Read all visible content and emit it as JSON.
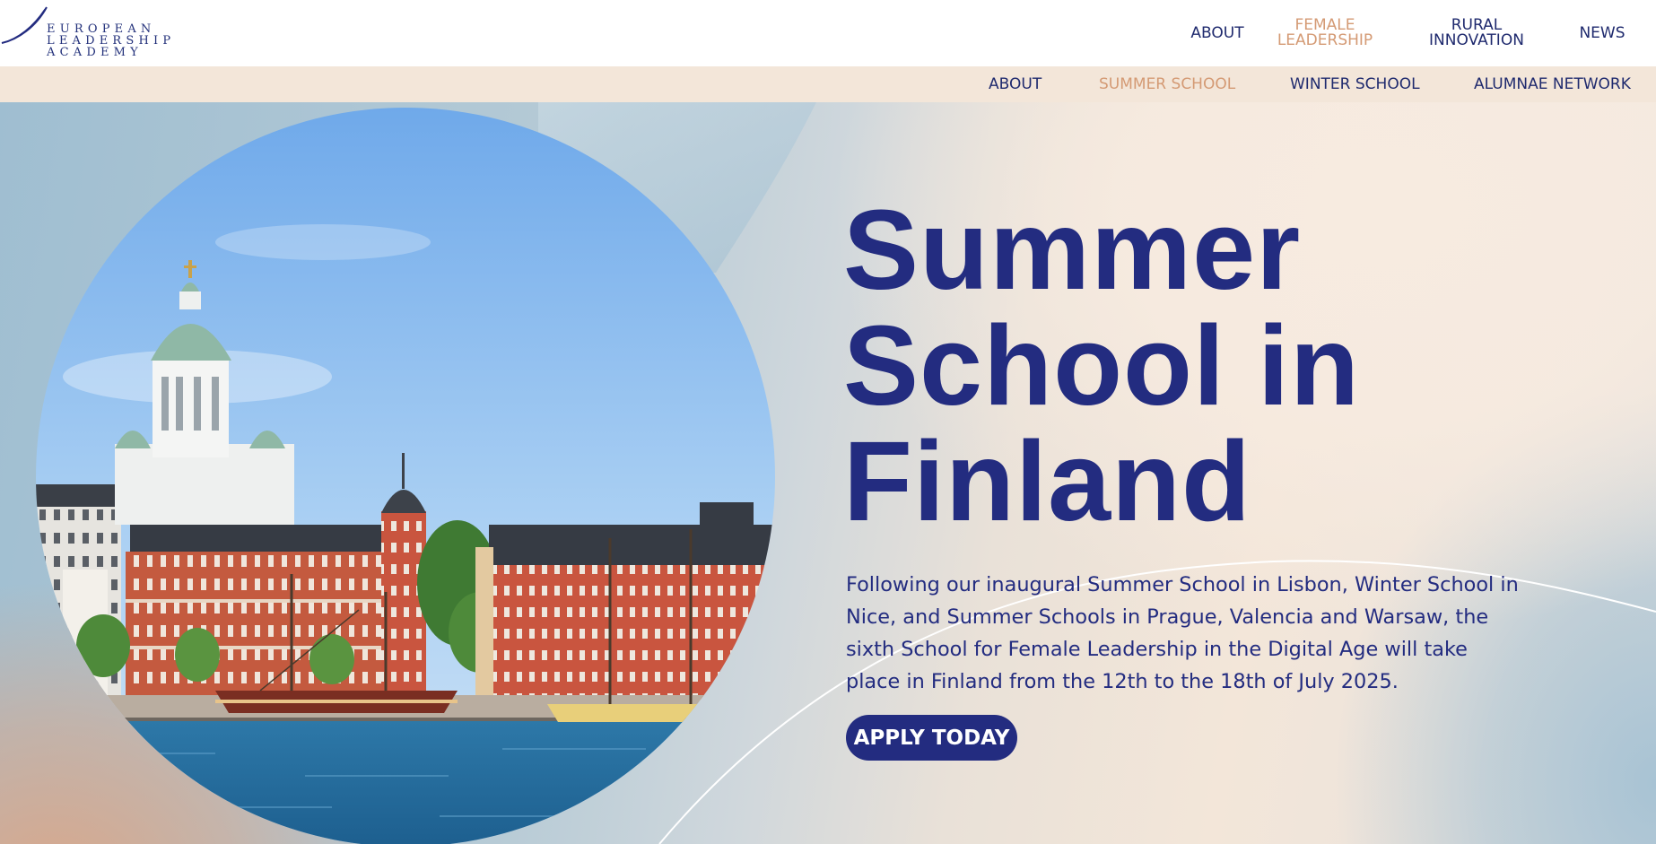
{
  "brand": {
    "logo_lines": [
      "EUROPEAN",
      "LEADERSHIP",
      "ACADEMY"
    ],
    "navy": "#232c80",
    "accent": "#d49a74",
    "subnav_bg": "#f3e6d9"
  },
  "main_nav": {
    "items": [
      {
        "label": "ABOUT",
        "active": false
      },
      {
        "label_line1": "FEMALE",
        "label_line2": "LEADERSHIP",
        "active": true
      },
      {
        "label_line1": "RURAL",
        "label_line2": "INNOVATION",
        "active": false
      },
      {
        "label": "NEWS",
        "active": false
      }
    ]
  },
  "sub_nav": {
    "items": [
      {
        "label": "ABOUT",
        "active": false
      },
      {
        "label": "SUMMER SCHOOL",
        "active": true
      },
      {
        "label": "WINTER SCHOOL",
        "active": false
      },
      {
        "label": "ALUMNAE NETWORK",
        "active": false
      }
    ]
  },
  "hero": {
    "title_lines": [
      "Summer",
      "School in",
      "Finland"
    ],
    "description": "Following our inaugural Summer School in Lisbon, Winter School in Nice, and Summer Schools in Prague, Valencia and Warsaw, the sixth School for Female Leadership in the Digital Age will take place in Finland from the 12th to the 18th of July 2025.",
    "cta_label": "APPLY TODAY",
    "photo_icon": "helsinki-cathedral-harbor-photo"
  }
}
